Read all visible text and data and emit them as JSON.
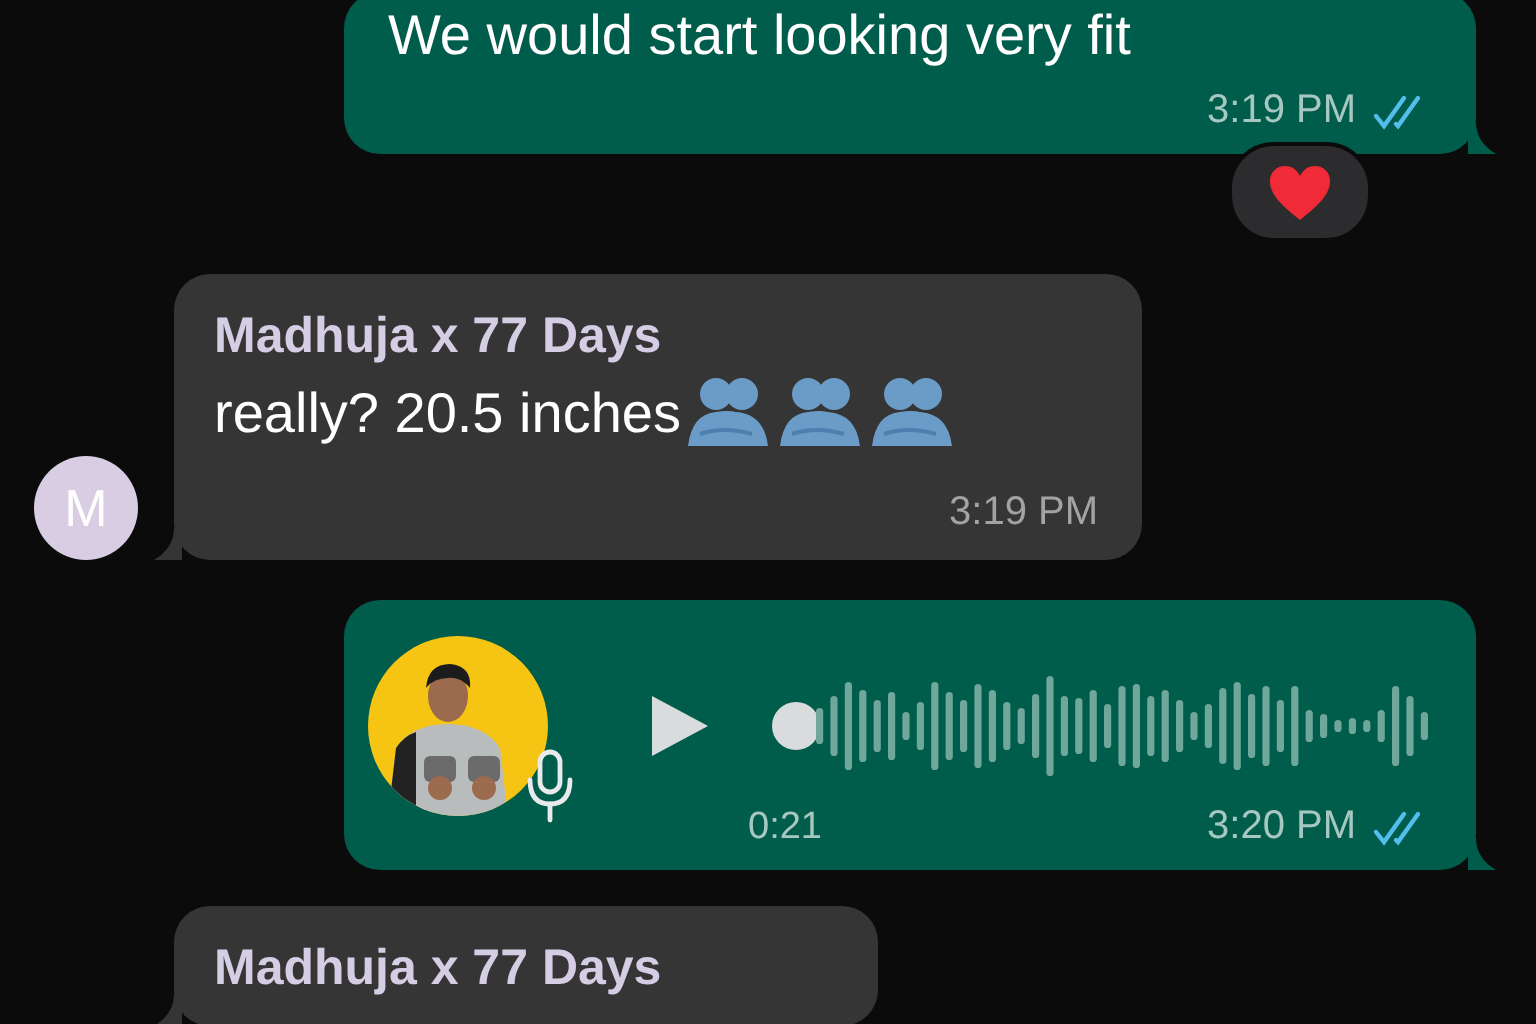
{
  "messages": [
    {
      "kind": "text",
      "sent": true,
      "text": "We would start looking very fit",
      "time": "3:19 PM",
      "read": true,
      "reaction": true
    },
    {
      "kind": "text",
      "sent": false,
      "sender": "Madhuja x 77 Days",
      "avatar": "M",
      "text": "really? 20.5 inches",
      "stickers": [
        {
          "kind": "people-hugging"
        },
        {
          "kind": "people-hugging"
        },
        {
          "kind": "people-hugging"
        }
      ],
      "time": "3:19 PM"
    },
    {
      "kind": "voice",
      "sent": true,
      "duration": "0:21",
      "time": "3:20 PM",
      "read": true
    },
    {
      "kind": "text",
      "sent": false,
      "sender": "Madhuja x 77 Days"
    }
  ]
}
